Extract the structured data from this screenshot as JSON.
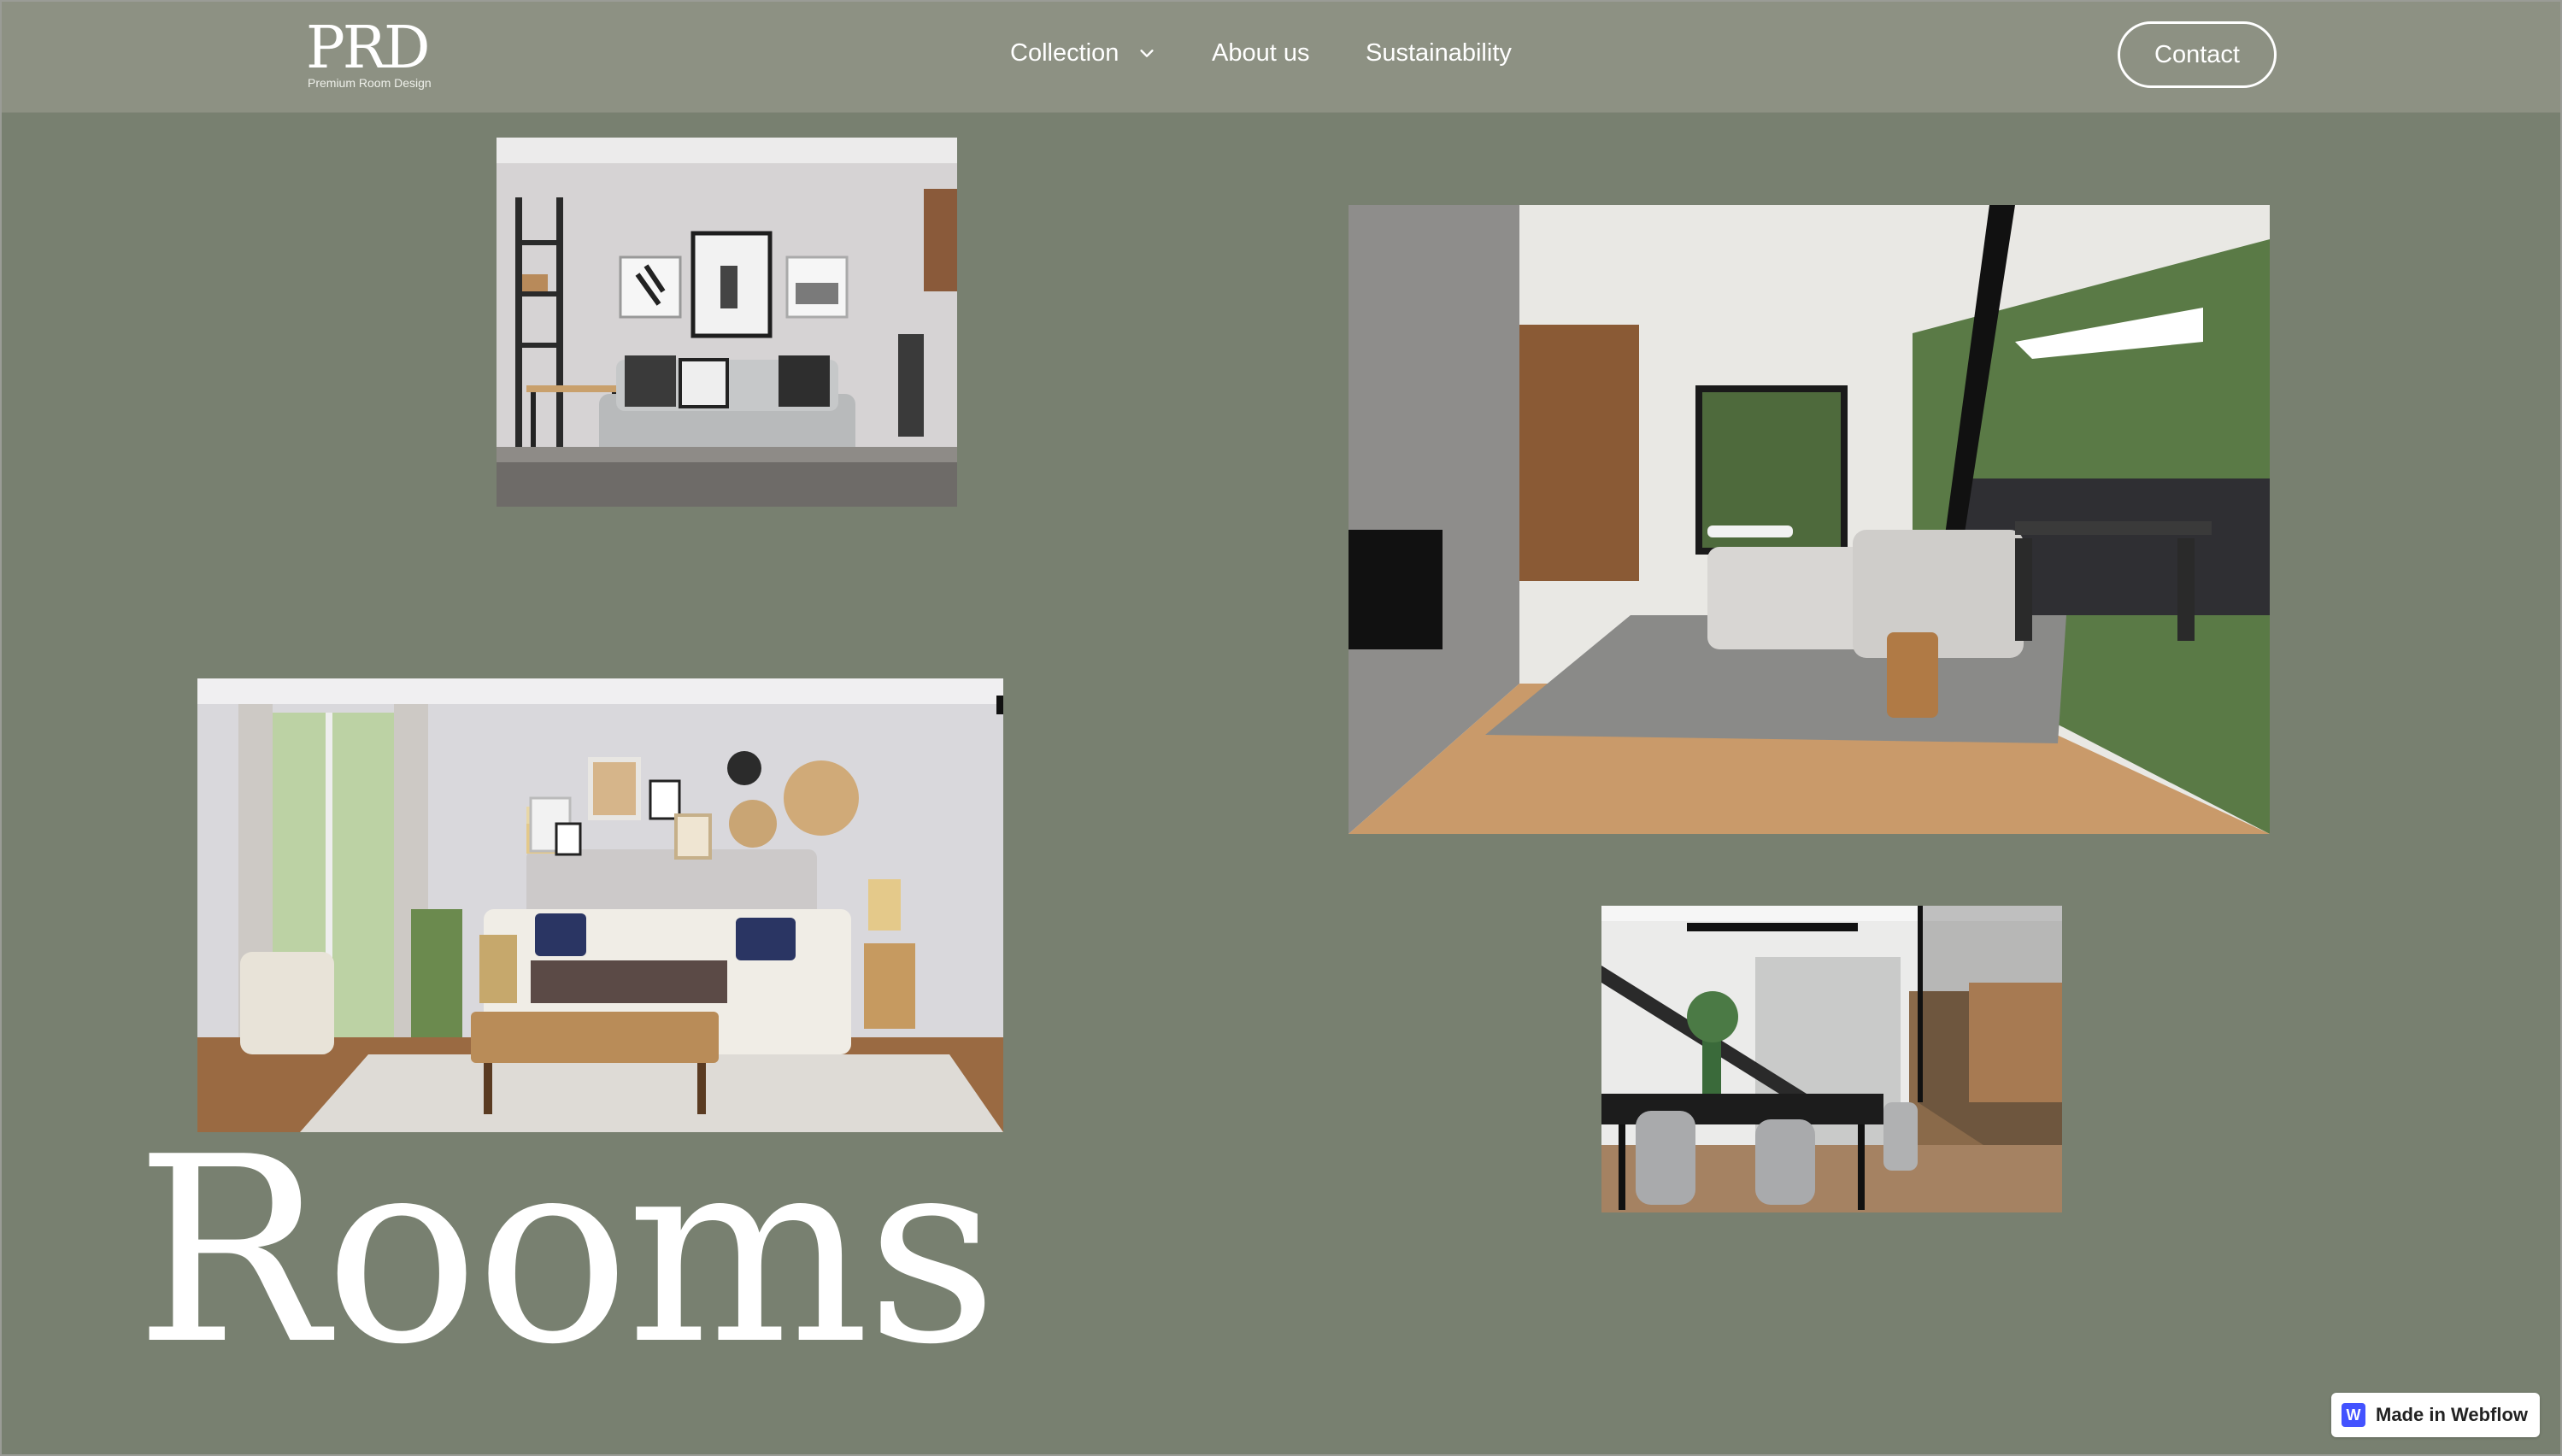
{
  "brand": {
    "mark": "PRD",
    "tagline": "Premium Room Design"
  },
  "nav": {
    "items": [
      {
        "label": "Collection",
        "has_dropdown": true
      },
      {
        "label": "About us"
      },
      {
        "label": "Sustainability"
      }
    ],
    "contact_label": "Contact"
  },
  "hero": {
    "heading": "Rooms"
  },
  "gallery": [
    {
      "subject": "living room with grey sofa and framed prints"
    },
    {
      "subject": "open-plan living area with sectional sofa and deck"
    },
    {
      "subject": "bedroom with bed, bench and gallery wall"
    },
    {
      "subject": "dining area with black table and staircase"
    }
  ],
  "badge": {
    "icon_letter": "W",
    "label": "Made in Webflow"
  },
  "colors": {
    "page_bg": "#788070",
    "nav_bg": "#8d9183",
    "text": "#ffffff",
    "badge_accent": "#4353ff"
  }
}
